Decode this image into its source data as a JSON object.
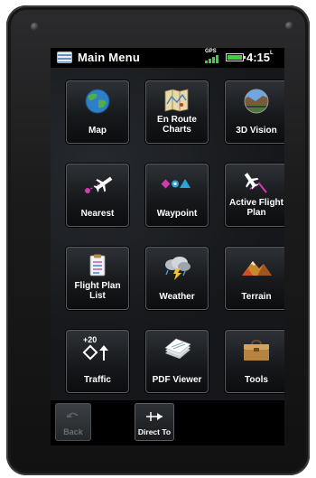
{
  "statusbar": {
    "title": "Main Menu",
    "gps_label": "GPS",
    "clock_time": "4:15",
    "clock_suffix": "L"
  },
  "tiles": [
    {
      "label": "Map",
      "icon": "globe-icon"
    },
    {
      "label": "En Route Charts",
      "icon": "folded-chart-icon"
    },
    {
      "label": "3D Vision",
      "icon": "terrain-view-icon"
    },
    {
      "label": "Nearest",
      "icon": "nearest-airplane-icon"
    },
    {
      "label": "Waypoint",
      "icon": "waypoint-symbols-icon"
    },
    {
      "label": "Active Flight Plan",
      "icon": "flight-plan-airplane-icon"
    },
    {
      "label": "Flight Plan List",
      "icon": "clipboard-list-icon"
    },
    {
      "label": "Weather",
      "icon": "storm-cloud-icon"
    },
    {
      "label": "Terrain",
      "icon": "mountain-icon"
    },
    {
      "label": "Traffic",
      "icon": "traffic-symbol-icon"
    },
    {
      "label": "PDF Viewer",
      "icon": "document-stack-icon"
    },
    {
      "label": "Tools",
      "icon": "toolbox-icon"
    }
  ],
  "traffic_icon_text": "+20",
  "bottombar": {
    "back_label": "Back",
    "direct_to_label": "Direct To"
  },
  "colors": {
    "battery": "#38d43a",
    "tile_border": "#565b61"
  }
}
